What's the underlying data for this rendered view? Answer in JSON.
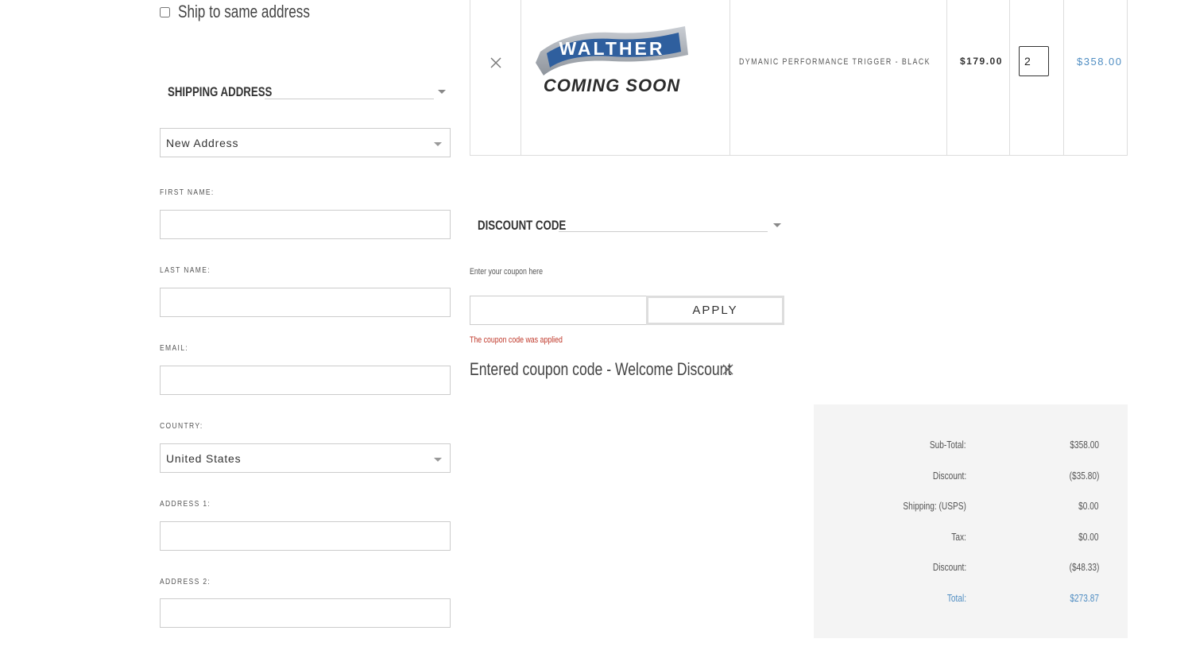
{
  "shipping": {
    "same_address_label": "Ship to same address",
    "section_title": "SHIPPING ADDRESS",
    "address_select_value": "New Address",
    "first_name_label": "FIRST NAME:",
    "last_name_label": "LAST NAME:",
    "email_label": "EMAIL:",
    "country_label": "COUNTRY:",
    "country_value": "United States",
    "address1_label": "ADDRESS 1:",
    "address2_label": "ADDRESS 2:"
  },
  "cart": {
    "item": {
      "remove_icon": "close-icon",
      "logo_brand": "WALTHER",
      "logo_caption": "COMING SOON",
      "name": "DYMANIC PERFORMANCE TRIGGER - BLACK",
      "price": "$179.00",
      "quantity": "2",
      "line_total": "$358.00"
    }
  },
  "discount": {
    "section_title": "DISCOUNT CODE",
    "hint": "Enter your coupon here",
    "apply_label": "APPLY",
    "success_message": "The coupon code was applied",
    "entered_text": "Entered coupon code - Welcome Discount",
    "remove_icon": "close-icon"
  },
  "totals": {
    "rows": [
      {
        "label": "Sub-Total:",
        "value": "$358.00"
      },
      {
        "label": "Discount:",
        "value": "($35.80)"
      },
      {
        "label": "Shipping: (USPS)",
        "value": "$0.00"
      },
      {
        "label": "Tax:",
        "value": "$0.00"
      },
      {
        "label": "Discount:",
        "value": "($48.33)"
      },
      {
        "label": "Total:",
        "value": "$273.87"
      }
    ]
  },
  "colors": {
    "accent_blue": "#4f8dc2",
    "success_red": "#c0392b",
    "totals_bg": "#f4f4f4"
  }
}
